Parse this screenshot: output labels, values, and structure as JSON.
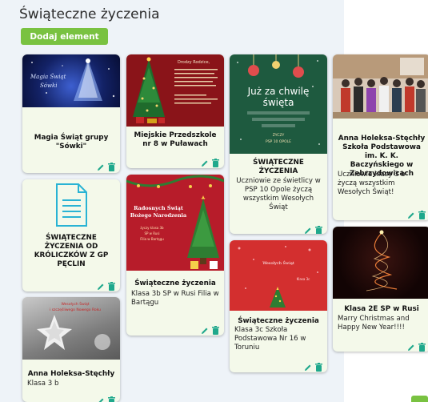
{
  "board": {
    "title": "Świąteczne życzenia",
    "add_button": "Dodaj element"
  },
  "cards": [
    {
      "title": "Magia Świąt grupy \"Sówki\"",
      "thumb": {
        "line1": "Magia Świąt",
        "line2": "Sówki"
      }
    },
    {
      "title": "Miejskie Przedszkole nr 8 w Puławach",
      "thumb": {
        "heading": "Drodzy Rodzice,"
      }
    },
    {
      "title": "ŚWIĄTECZNE ŻYCZENIA",
      "desc": "Uczniowie ze świetlicy w PSP 10 Opole życzą wszystkim Wesołych Świąt",
      "thumb": {
        "line1": "Już za chwilę",
        "line2": "święta",
        "line3": "WESOŁYCH, RADOSNYCH, ZDROWYCH I RODZINNYCH ŚWIĄT",
        "line4": "ŻYCZY",
        "line5": "PSP 10 OPOLE"
      }
    },
    {
      "title": "Anna Holeksa-Stęchły Szkoła Podstawowa im. K. K. Baczyńskiego w Zebrzydowicach",
      "desc": "Uczniowie klasy 3 b życzą wszystkim Wesołych Świąt!"
    },
    {
      "title": "ŚWIĄTECZNE ŻYCZENIA OD KRÓLICZKÓW Z GP PĘCLIN"
    },
    {
      "title": "Świąteczne życzenia",
      "desc": "Klasa 3b SP w Rusi Filia w Bartągu",
      "thumb": {
        "line1": "Radosnych Świąt",
        "line2": "Bożego Narodzenia",
        "line3": "życzy klasa 3b",
        "line4": "SP w Rusi",
        "line5": "Filia w Bartągu"
      }
    },
    {
      "title": "Świąteczne życzenia",
      "desc": "Klasa 3c Szkoła Podstawowa Nr 16 w Toruniu",
      "thumb": {
        "line1": "Wesołych Świąt",
        "line2": "Klasa 3c"
      }
    },
    {
      "title": "Klasa 2E SP w Rusi",
      "desc": "Marry Christmas and Happy New Year!!!!"
    },
    {
      "title": "Anna Holeksa-Stęchły",
      "desc": "Klasa 3 b",
      "thumb": {
        "line1": "Wesołych Świąt",
        "line2": "i szczęśliwego Nowego Roku"
      }
    }
  ],
  "colors": {
    "accent": "#79c241",
    "action": "#1fa88c",
    "card_bg": "#f4f9ea",
    "board_bg": "#eef3f8"
  }
}
